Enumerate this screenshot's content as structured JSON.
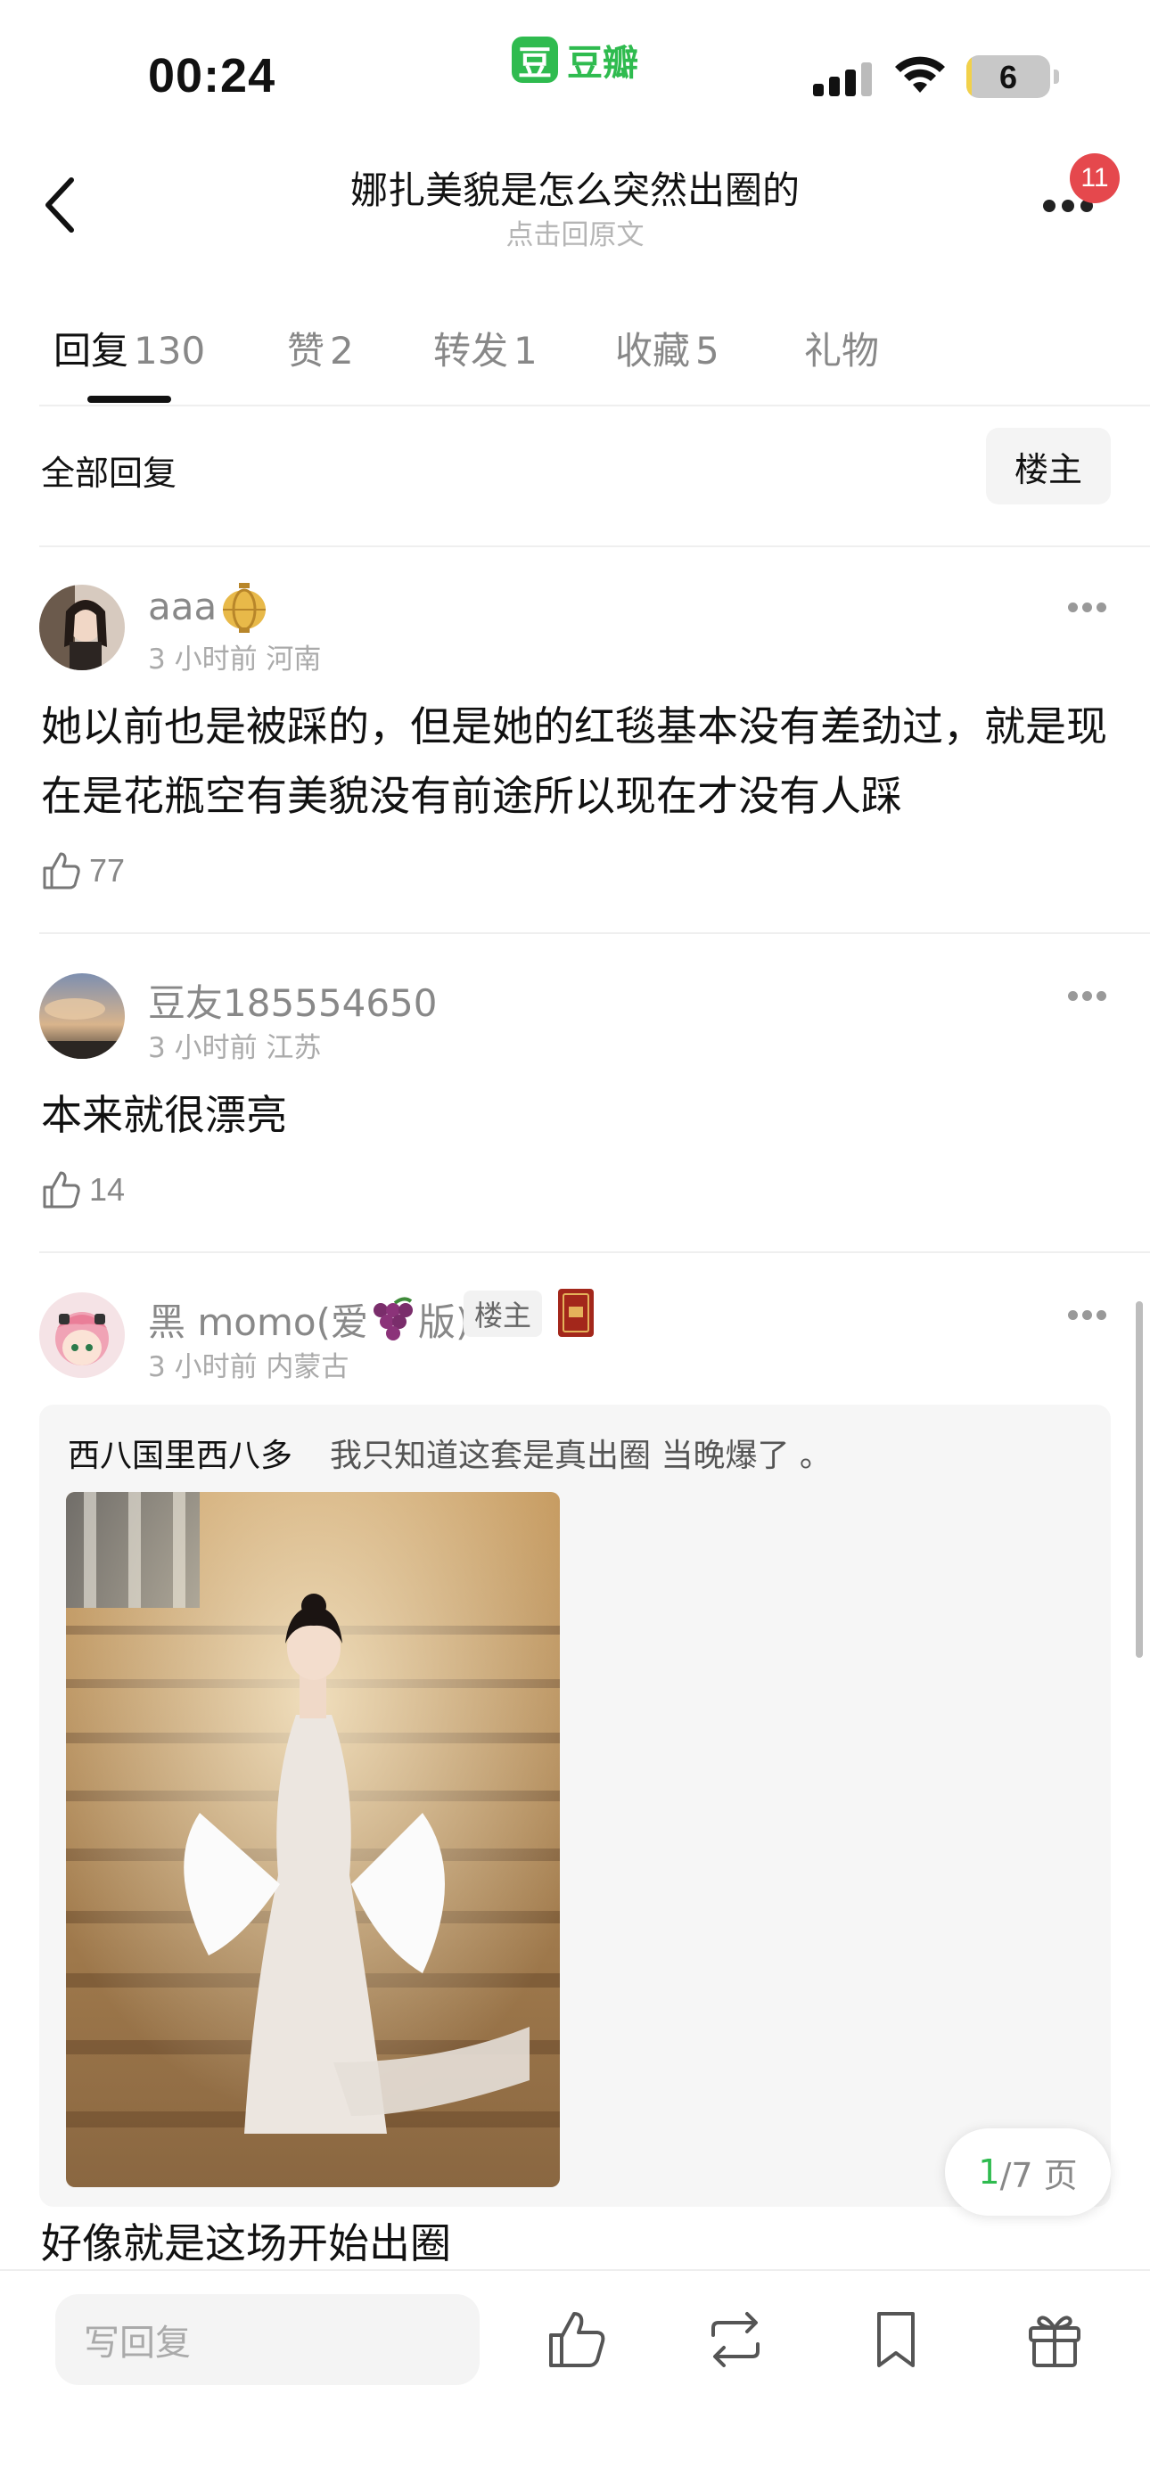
{
  "status_bar": {
    "time": "00:24",
    "app_logo_glyph": "豆",
    "app_name": "豆瓣",
    "battery": "6",
    "battery_level_percent": 6,
    "brand_color": "#2fbb4f"
  },
  "nav": {
    "title": "娜扎美貌是怎么突然出圈的",
    "subtitle": "点击回原文",
    "notification_count": "11"
  },
  "tabs": [
    {
      "label": "回复",
      "count": "130",
      "active": true
    },
    {
      "label": "赞",
      "count": "2"
    },
    {
      "label": "转发",
      "count": "1"
    },
    {
      "label": "收藏",
      "count": "5"
    },
    {
      "label": "礼物",
      "count": ""
    }
  ],
  "filter": {
    "label": "全部回复",
    "op_filter": "楼主"
  },
  "comments": [
    {
      "username": "aaa",
      "meta": "3 小时前  河南",
      "text": "她以前也是被踩的，但是她的红毯基本没有差劲过，就是现在是花瓶空有美貌没有前途所以现在才没有人踩",
      "likes": "77",
      "badge_icon": "lantern-icon"
    },
    {
      "username": "豆友185554650",
      "meta": "3 小时前  江苏",
      "text": "本来就很漂亮",
      "likes": "14"
    },
    {
      "username_prefix": "黑 momo(爱",
      "username_suffix": "版)",
      "username_emoji": "grape-icon",
      "op_badge": "楼主",
      "meta": "3 小时前  内蒙古",
      "quote": {
        "user": "西八国里西八多",
        "text": "我只知道这套是真出圈 当晚爆了 。"
      },
      "text": "好像就是这场开始出圈"
    }
  ],
  "pager": {
    "current": "1",
    "total": "/7 页"
  },
  "bottom_bar": {
    "reply_placeholder": "写回复",
    "icons": [
      "like-icon",
      "repost-icon",
      "bookmark-icon",
      "gift-icon"
    ]
  }
}
